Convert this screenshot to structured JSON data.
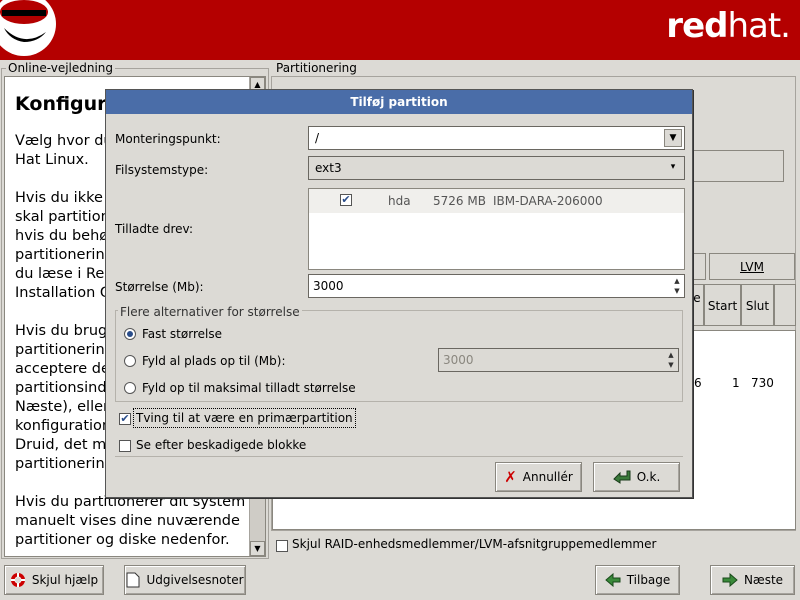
{
  "header": {
    "brand_bold": "red",
    "brand_light": "hat."
  },
  "help": {
    "frame_label": "Online-vejledning",
    "title": "Konfigura",
    "paragraphs": [
      "Vælg hvor du\nHat Linux.",
      "Hvis du ikke\nskal partition\nhvis du behø\npartitionering\ndu læse i Re\nInstallation G",
      "Hvis du brug\npartitionering\nacceptere de\npartitionsind\nNæste), eller\nkonfiguration\nDruid, det ma\npartitionering",
      "Hvis du partitionerer dit system\nmanuelt vises dine nuværende\npartitioner og diske nedenfor."
    ]
  },
  "partition_panel": {
    "frame_label": "Partitionering",
    "lvm_button": "LVM",
    "columns": [
      "Start",
      "Slut"
    ],
    "row_values": [
      "6",
      "1",
      "730"
    ],
    "hide_raid_label": "Skjul RAID-enhedsmedlemmer/LVM-afsnitgruppemedlemmer"
  },
  "dialog": {
    "title": "Tilføj partition",
    "mount_label": "Monteringspunkt:",
    "mount_value": "/",
    "fstype_label": "Filsystemstype:",
    "fstype_value": "ext3",
    "drives_label": "Tilladte drev:",
    "drive": {
      "name": "hda",
      "size": "5726 MB",
      "model": "IBM-DARA-206000"
    },
    "size_label": "Størrelse (Mb):",
    "size_value": "3000",
    "size_options_label": "Flere alternativer for størrelse",
    "opt_fixed": "Fast størrelse",
    "opt_fill_upto": "Fyld al plads op til (Mb):",
    "opt_fill_upto_value": "3000",
    "opt_fill_max": "Fyld op til maksimal tilladt størrelse",
    "force_primary": "Tving til at være en primærpartition",
    "check_bad_blocks": "Se efter beskadigede blokke",
    "cancel_button": "Annullér",
    "ok_button": "O.k."
  },
  "footer": {
    "hide_help": "Skjul hjælp",
    "release_notes": "Udgivelsesnoter",
    "back": "Tilbage",
    "next": "Næste"
  },
  "colors": {
    "header": "#b40000",
    "dialog_title": "#4a6da8",
    "background": "#dcdad5"
  }
}
